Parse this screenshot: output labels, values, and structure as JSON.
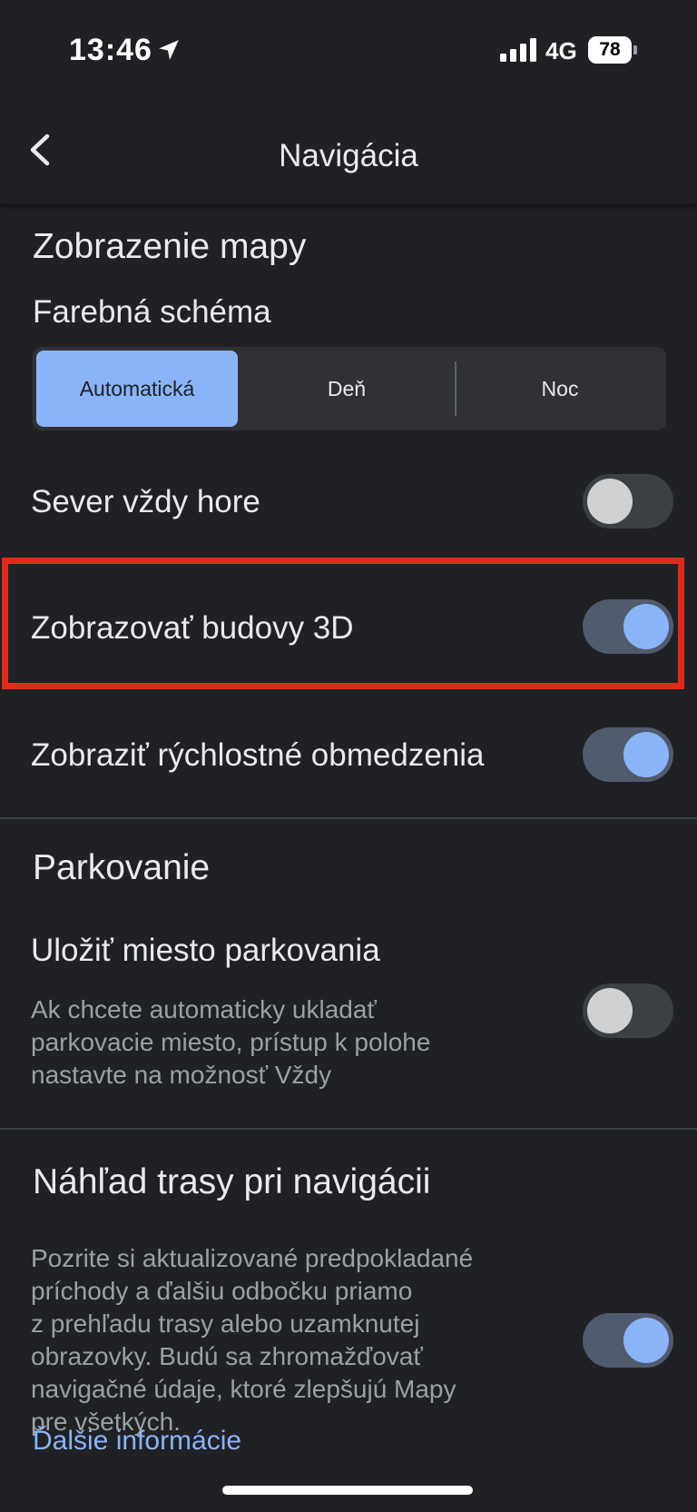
{
  "status_bar": {
    "time": "13:46",
    "network": "4G",
    "battery": "78"
  },
  "header": {
    "title": "Navigácia"
  },
  "map_display": {
    "section_title": "Zobrazenie mapy",
    "color_scheme_label": "Farebná schéma",
    "color_scheme_options": [
      "Automatická",
      "Deň",
      "Noc"
    ],
    "color_scheme_selected": "Automatická",
    "north_up": {
      "label": "Sever vždy hore",
      "enabled": false
    },
    "buildings_3d": {
      "label": "Zobrazovať budovy 3D",
      "enabled": true
    },
    "speed_limits": {
      "label": "Zobraziť rýchlostné obmedzenia",
      "enabled": true
    }
  },
  "parking": {
    "section_title": "Parkovanie",
    "save_location": {
      "label": "Uložiť miesto parkovania",
      "description_lines": [
        "Ak chcete automaticky ukladať",
        "parkovacie miesto, prístup k polohe",
        "nastavte na možnosť Vždy"
      ],
      "enabled": false
    }
  },
  "route_preview": {
    "section_title": "Náhľad trasy pri navigácii",
    "description_lines": [
      "Pozrite si aktualizované predpokladané",
      "príchody a ďalšiu odbočku priamo",
      "z prehľadu trasy alebo uzamknutej",
      "obrazovky. Budú sa zhromažďovať",
      "navigačné údaje, ktoré zlepšujú Mapy",
      "pre všetkých."
    ],
    "enabled": true,
    "more_info_link": "Ďalšie informácie"
  },
  "colors": {
    "background": "#202124",
    "accent": "#8ab4f8",
    "highlight_frame": "#e22a1c"
  }
}
